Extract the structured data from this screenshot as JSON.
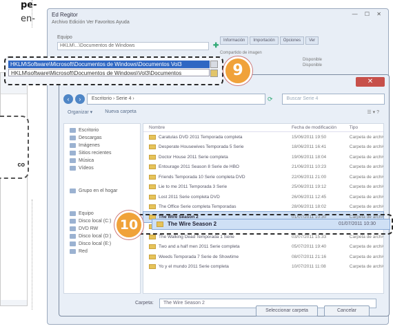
{
  "magazine": {
    "line1": "pe-",
    "line2": "en-",
    "callout_text": "co"
  },
  "registry_window": {
    "title": "Ed Regitor",
    "window_buttons": "— ☐ ✕",
    "menu": "Archivo  Edición  Ver  Favoritos  Ayuda",
    "path_label": "Equipo",
    "path_value": "HKLM\\...\\Documentos de Windows",
    "tabs": [
      "Información",
      "Importación",
      "Opciones",
      "Ver"
    ],
    "side_text": [
      "Compartido de imagen",
      "Disponible",
      "Disponible"
    ]
  },
  "highlight_9": {
    "line_a": "HKLM\\Software\\Microsoft\\Documentos de Windows\\Documentos Vol3",
    "line_b": "HKLM\\software\\Microsoft\\Documentos de Windows\\Vol3\\Documentos"
  },
  "dialog": {
    "close_label": "✕",
    "back_label": "‹",
    "forward_label": "›",
    "path": "Escritorio › Serie 4 ›",
    "search_placeholder": "Buscar Serie 4",
    "organize": "Organizar ▾",
    "new_folder": "Nueva carpeta",
    "view_label": "☰ ▾  ?",
    "tree_top": [
      "Escritorio",
      "Descargas",
      "Imágenes",
      "Sitios recientes",
      "Música",
      "Vídeos"
    ],
    "tree_mid": [
      "Grupo en el hogar"
    ],
    "tree_bottom": [
      "Equipo",
      "Disco local (C:)",
      "DVD RW",
      "Disco local (D:)",
      "Disco local (E:)",
      "Red"
    ],
    "columns": [
      "Nombre",
      "Fecha de modificación",
      "Tipo"
    ],
    "rows": [
      {
        "name": "Caratulas DVD 2011 Temporada completa",
        "date": "15/06/2011 19:50",
        "type": "Carpeta de archivos"
      },
      {
        "name": "Desperate Housewives Temporada 5 Serie",
        "date": "18/06/2011 16:41",
        "type": "Carpeta de archivos"
      },
      {
        "name": "Doctor House 2011 Serie completa",
        "date": "19/06/2011 18:04",
        "type": "Carpeta de archivos"
      },
      {
        "name": "Entourage 2011 Season 8 Serie de HBO",
        "date": "21/06/2011 10:23",
        "type": "Carpeta de archivos"
      },
      {
        "name": "Friends Temporada 10 Serie completa DVD",
        "date": "22/06/2011 21:00",
        "type": "Carpeta de archivos"
      },
      {
        "name": "Lie to me 2011 Temporada 3 Serie",
        "date": "25/06/2011 19:12",
        "type": "Carpeta de archivos"
      },
      {
        "name": "Lost 2011 Serie completa DVD",
        "date": "26/06/2011 12:45",
        "type": "Carpeta de archivos"
      },
      {
        "name": "The Office Serie completa Temporadas",
        "date": "28/06/2011 18:02",
        "type": "Carpeta de archivos"
      },
      {
        "name": "The Wire Season 2",
        "date": "01/07/2011 10:30",
        "type": "Carpeta de archivos",
        "selected": true
      },
      {
        "name": "The Big Bang Theory Season 4",
        "date": "02/07/2011 14:11",
        "type": "Carpeta de archivos"
      },
      {
        "name": "The Walking Dead Temporada 1 Serie",
        "date": "03/07/2011 15:33",
        "type": "Carpeta de archivos"
      },
      {
        "name": "Two and a half men 2011 Serie completa",
        "date": "05/07/2011 19:40",
        "type": "Carpeta de archivos"
      },
      {
        "name": "Weeds Temporada 7 Serie de Showtime",
        "date": "08/07/2011 21:16",
        "type": "Carpeta de archivos"
      },
      {
        "name": "Yo y el mundo 2011 Serie completa",
        "date": "10/07/2011 11:08",
        "type": "Carpeta de archivos"
      }
    ],
    "filename_label": "Carpeta:",
    "filename_value": "The Wire Season 2",
    "select_button": "Seleccionar carpeta",
    "cancel_button": "Cancelar"
  },
  "highlight_10": {
    "row_name": "The Wire Season 2",
    "row_date": "01/07/2011 10:30"
  },
  "badges": {
    "nine": "9",
    "ten": "10"
  },
  "colors": {
    "badge": "#f0a23a",
    "selection": "#2f67c3"
  }
}
